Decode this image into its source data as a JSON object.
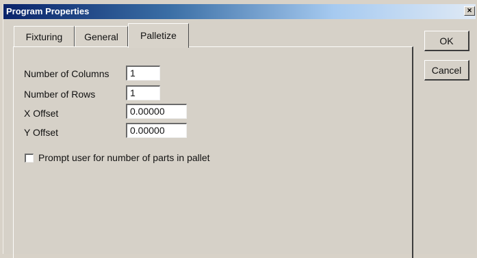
{
  "window": {
    "title": "Program Properties",
    "close_glyph": "×"
  },
  "tabs": [
    {
      "label": "Fixturing",
      "active": false
    },
    {
      "label": "General",
      "active": false
    },
    {
      "label": "Palletize",
      "active": true
    }
  ],
  "form": {
    "columns_label": "Number of Columns",
    "columns_value": "1",
    "rows_label": "Number of Rows",
    "rows_value": "1",
    "x_offset_label": "X Offset",
    "x_offset_value": "0.00000",
    "y_offset_label": "Y Offset",
    "y_offset_value": "0.00000",
    "prompt_label": "Prompt user for number of parts in pallet",
    "prompt_checked": false
  },
  "buttons": {
    "ok": "OK",
    "cancel": "Cancel"
  },
  "colors": {
    "titlebar_start": "#0a246a",
    "titlebar_end": "#dfe9f5",
    "face": "#d6d1c8"
  }
}
